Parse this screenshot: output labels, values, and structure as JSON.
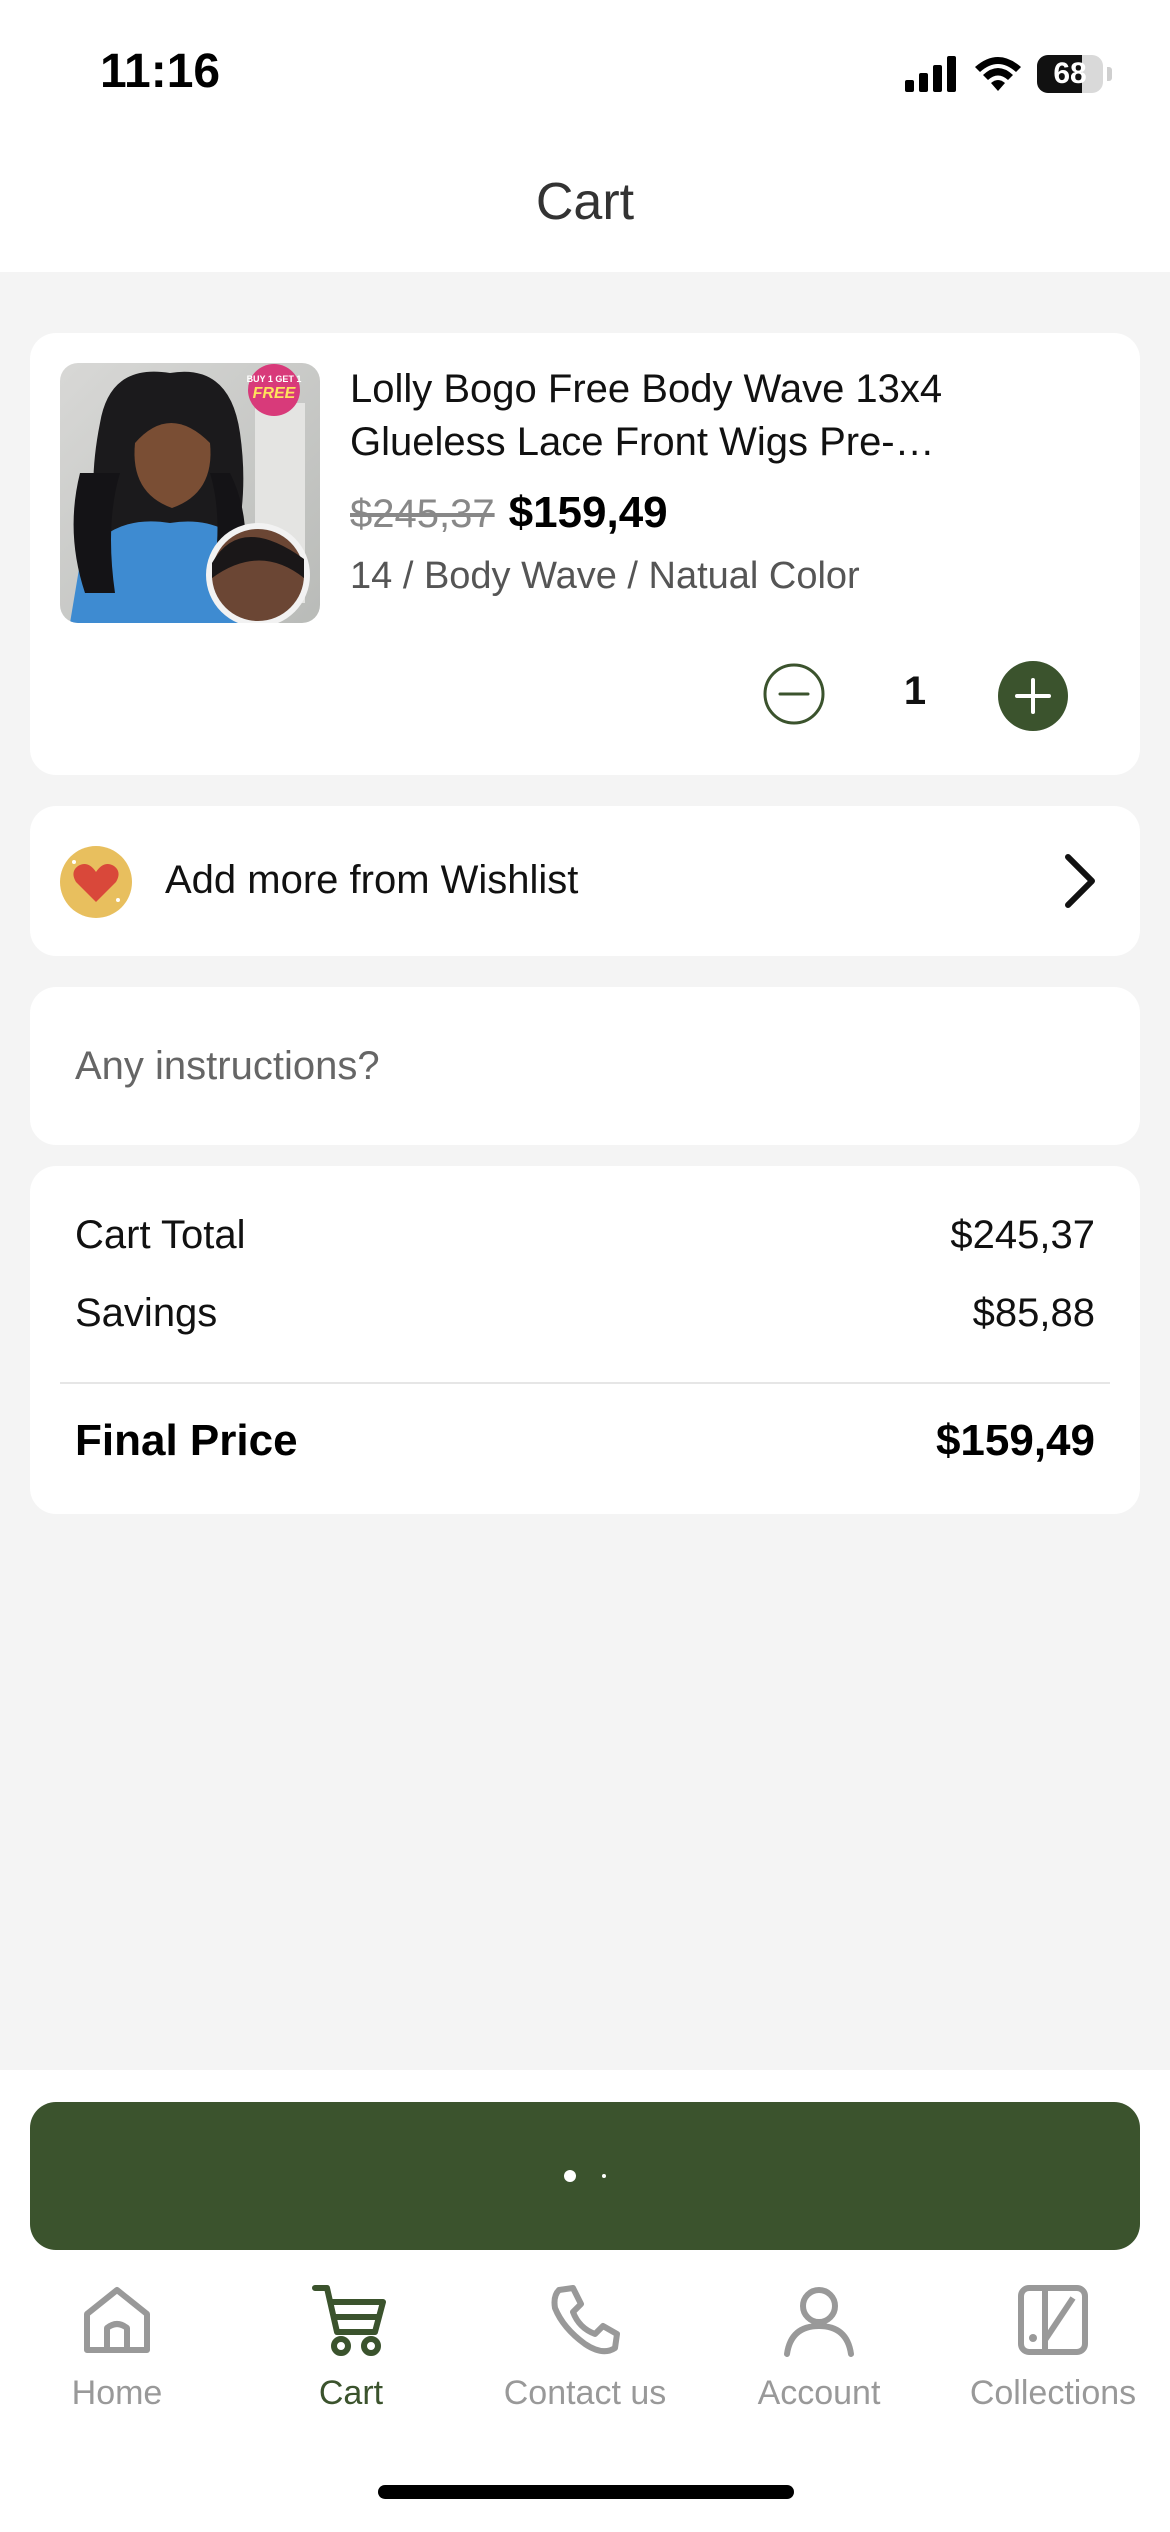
{
  "status_bar": {
    "time": "11:16",
    "battery_text": "68",
    "battery_level": 0.68
  },
  "header": {
    "title": "Cart"
  },
  "cart": {
    "items": [
      {
        "title": "Lolly Bogo Free Body Wave 13x4 Glueless Lace Front Wigs Pre-…",
        "badge_lines": [
          "BUY 1 GET 1",
          "FREE"
        ],
        "original_price": "$245,37",
        "price": "$159,49",
        "variant": "14 / Body Wave / Natual Color",
        "quantity": "1"
      }
    ]
  },
  "wishlist": {
    "label": "Add more from Wishlist",
    "icon": "heart-icon",
    "chevron_icon": "chevron-right-icon"
  },
  "instructions": {
    "placeholder": "Any instructions?",
    "value": ""
  },
  "totals": {
    "cart_total_label": "Cart Total",
    "cart_total_value": "$245,37",
    "savings_label": "Savings",
    "savings_value": "$85,88",
    "final_label": "Final Price",
    "final_value": "$159,49"
  },
  "checkout": {
    "state": "loading"
  },
  "tabs": [
    {
      "label": "Home",
      "icon": "home-icon",
      "active": false
    },
    {
      "label": "Cart",
      "icon": "cart-icon",
      "active": true
    },
    {
      "label": "Contact us",
      "icon": "phone-icon",
      "active": false
    },
    {
      "label": "Account",
      "icon": "account-icon",
      "active": false
    },
    {
      "label": "Collections",
      "icon": "collections-icon",
      "active": false
    }
  ],
  "colors": {
    "brand": "#3b532d",
    "background": "#f4f4f4",
    "card": "#ffffff",
    "inactive_tab": "#999999"
  }
}
